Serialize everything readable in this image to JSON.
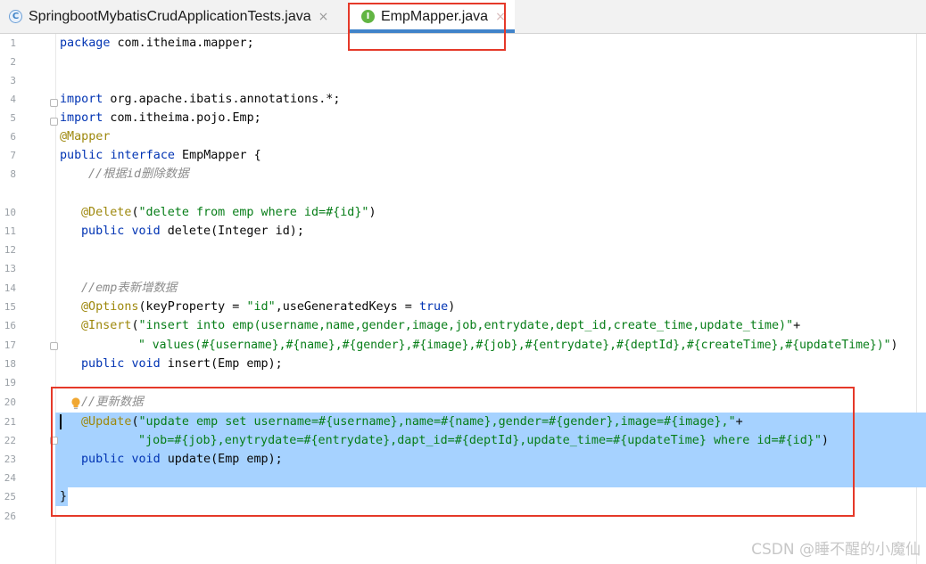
{
  "tabs": [
    {
      "label": "SpringbootMybatisCrudApplicationTests.java",
      "icon": "C",
      "close": "×"
    },
    {
      "label": "EmpMapper.java",
      "icon": "I",
      "close": "×"
    }
  ],
  "line_numbers": [
    "1",
    "2",
    "3",
    "4",
    "5",
    "6",
    "7",
    "8",
    "10",
    "11",
    "12",
    "13",
    "14",
    "15",
    "16",
    "17",
    "18",
    "19",
    "20",
    "21",
    "22",
    "23",
    "24",
    "25",
    "26"
  ],
  "code": {
    "l1_kw": "package",
    "l1_rest": " com.itheima.mapper;",
    "l4_kw": "import",
    "l4_rest": " org.apache.ibatis.annotations.*;",
    "l5_kw": "import",
    "l5_rest": " com.itheima.pojo.Emp;",
    "l6_ann": "@Mapper",
    "l7_kw1": "public",
    "l7_kw2": "interface",
    "l7_rest": " EmpMapper {",
    "l8_cm": "//根据id删除数据",
    "l10_ann": "@Delete",
    "l10_p1": "(",
    "l10_st": "\"delete from emp where id=#{id}\"",
    "l10_p2": ")",
    "l11_kw1": "public",
    "l11_kw2": "void",
    "l11_rest": " delete(Integer id);",
    "l14_cm": "//emp表新增数据",
    "l15_ann": "@Options",
    "l15_p1": "(keyProperty = ",
    "l15_st": "\"id\"",
    "l15_p2": ",useGeneratedKeys = ",
    "l15_kw": "true",
    "l15_p3": ")",
    "l16_ann": "@Insert",
    "l16_p1": "(",
    "l16_st": "\"insert into emp(username,name,gender,image,job,entrydate,dept_id,create_time,update_time)\"",
    "l16_p2": "+",
    "l17_st": "\" values(#{username},#{name},#{gender},#{image},#{job},#{entrydate},#{deptId},#{createTime},#{updateTime})\"",
    "l17_p": ")",
    "l18_kw1": "public",
    "l18_kw2": "void",
    "l18_rest": " insert(Emp emp);",
    "l20_cm": "//更新数据",
    "l21_ann": "@Update",
    "l21_p1": "(",
    "l21_st": "\"update emp set username=#{username},name=#{name},gender=#{gender},image=#{image},\"",
    "l21_p2": "+",
    "l22_st": "\"job=#{job},enytrydate=#{entrydate},dapt_id=#{deptId},update_time=#{updateTime} where id=#{id}\"",
    "l22_p": ")",
    "l23_kw1": "public",
    "l23_kw2": "void",
    "l23_rest": " update(Emp emp);",
    "l25": "}"
  },
  "watermark": "CSDN @睡不醒的小魔仙",
  "colors": {
    "keyword": "#0033b3",
    "annotation": "#9e880d",
    "string": "#067d17",
    "comment": "#8c8c8c",
    "selection": "#a6d2ff",
    "highlight_box": "#e53929"
  }
}
